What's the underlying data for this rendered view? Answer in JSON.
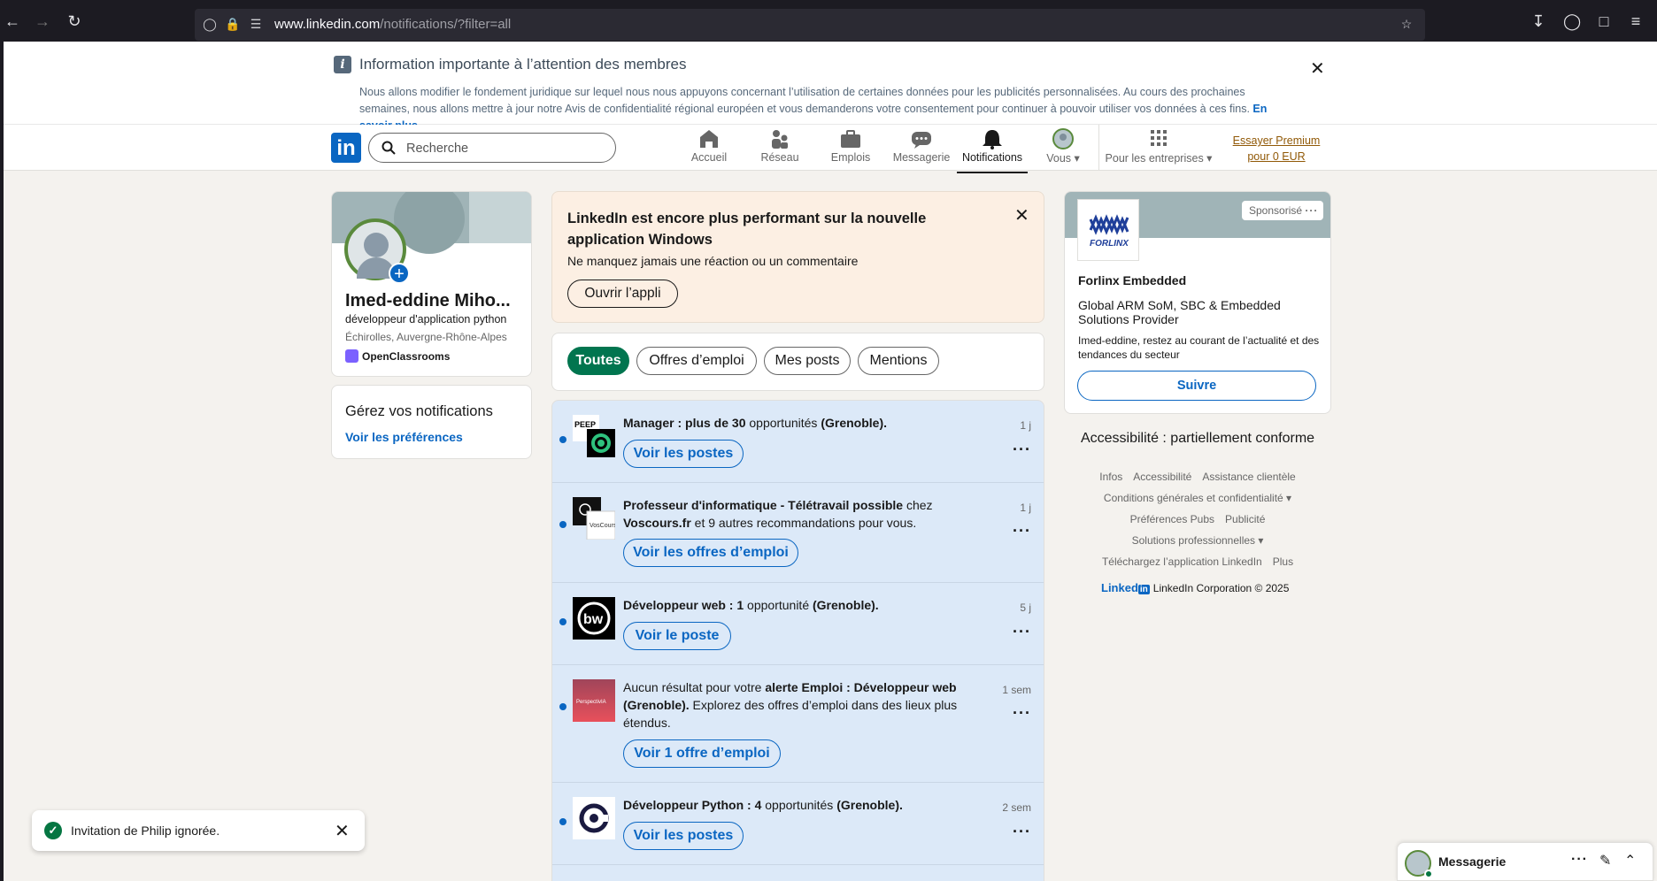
{
  "browser": {
    "url_domain": "www.linkedin.com",
    "url_path": "/notifications/?filter=all"
  },
  "banner": {
    "title": "Information importante à l’attention des membres",
    "text": "Nous allons modifier le fondement juridique sur lequel nous nous appuyons concernant l’utilisation de certaines données pour les publicités personnalisées. Au cours des prochaines semaines, nous allons mettre à jour notre Avis de confidentialité régional européen et vous demanderons votre consentement pour continuer à pouvoir utiliser vos données à ces fins.",
    "link": "En savoir plus"
  },
  "nav": {
    "search_placeholder": "Recherche",
    "items": [
      {
        "label": "Accueil",
        "icon": "home-icon"
      },
      {
        "label": "Réseau",
        "icon": "network-icon"
      },
      {
        "label": "Emplois",
        "icon": "briefcase-icon"
      },
      {
        "label": "Messagerie",
        "icon": "message-icon"
      },
      {
        "label": "Notifications",
        "icon": "bell-icon"
      },
      {
        "label": "Vous",
        "icon": "avatar-icon"
      }
    ],
    "business": "Pour les entreprises",
    "premium": "Essayer Premium pour 0 EUR"
  },
  "profile": {
    "name": "Imed-eddine Miho...",
    "title": "développeur d'application python",
    "location": "Échirolles, Auvergne-Rhône-Alpes",
    "org": "OpenClassrooms"
  },
  "manage": {
    "title": "Gérez vos notifications",
    "link": "Voir les préférences"
  },
  "promo": {
    "title": "LinkedIn est encore plus performant sur la nouvelle application Windows",
    "subtitle": "Ne manquez jamais une réaction ou un commentaire",
    "button": "Ouvrir l’appli"
  },
  "filters": [
    "Toutes",
    "Offres d’emploi",
    "Mes posts",
    "Mentions"
  ],
  "notifications": [
    {
      "bold1": "Manager : plus de 30",
      "text1": " opportunités ",
      "bold2": "(Grenoble).",
      "text2": "",
      "time": "1 j",
      "button": "Voir les postes"
    },
    {
      "bold1": "Professeur d'informatique - Télétravail possible",
      "text1": " chez ",
      "bold2": "Voscours.fr",
      "text2": " et 9 autres recommandations pour vous.",
      "time": "1 j",
      "button": "Voir les offres d’emploi"
    },
    {
      "bold1": "Développeur web : 1",
      "text1": " opportunité ",
      "bold2": "(Grenoble).",
      "text2": "",
      "time": "5 j",
      "button": "Voir le poste"
    },
    {
      "bold1": "",
      "text1": "Aucun résultat pour votre ",
      "bold2": "alerte Emploi : Développeur web (Grenoble).",
      "text2": " Explorez des offres d’emploi dans des lieux plus étendus.",
      "time": "1 sem",
      "button": "Voir 1 offre d’emploi"
    },
    {
      "bold1": "Développeur Python : 4",
      "text1": " opportunités ",
      "bold2": "(Grenoble).",
      "text2": "",
      "time": "2 sem",
      "button": "Voir les postes"
    }
  ],
  "ad": {
    "sponsored": "Sponsorisé",
    "logo_text": "FORLINX",
    "name": "Forlinx Embedded",
    "description": "Global ARM SoM, SBC & Embedded Solutions Provider",
    "message": "Imed-eddine, restez au courant de l’actualité et des tendances du secteur",
    "button": "Suivre"
  },
  "accessibility": "Accessibilité : partiellement conforme",
  "footer": {
    "row1": [
      "Infos",
      "Accessibilité",
      "Assistance clientèle"
    ],
    "row2": [
      "Conditions générales et confidentialité ▾"
    ],
    "row3": [
      "Préférences Pubs",
      "Publicité"
    ],
    "row4": [
      "Solutions professionnelles ▾"
    ],
    "row5": [
      "Téléchargez l’application LinkedIn",
      "Plus"
    ],
    "brand": "Linked",
    "brand_in": "in",
    "copyright": "LinkedIn Corporation © 2025"
  },
  "toast": {
    "text": "Invitation de Philip ignorée."
  },
  "messaging": {
    "title": "Messagerie"
  },
  "colors": {
    "linkedin_blue": "#0a66c2",
    "active_filter": "#01754f",
    "notif_bg": "#dce9f8",
    "promo_bg": "#fcefe3"
  }
}
